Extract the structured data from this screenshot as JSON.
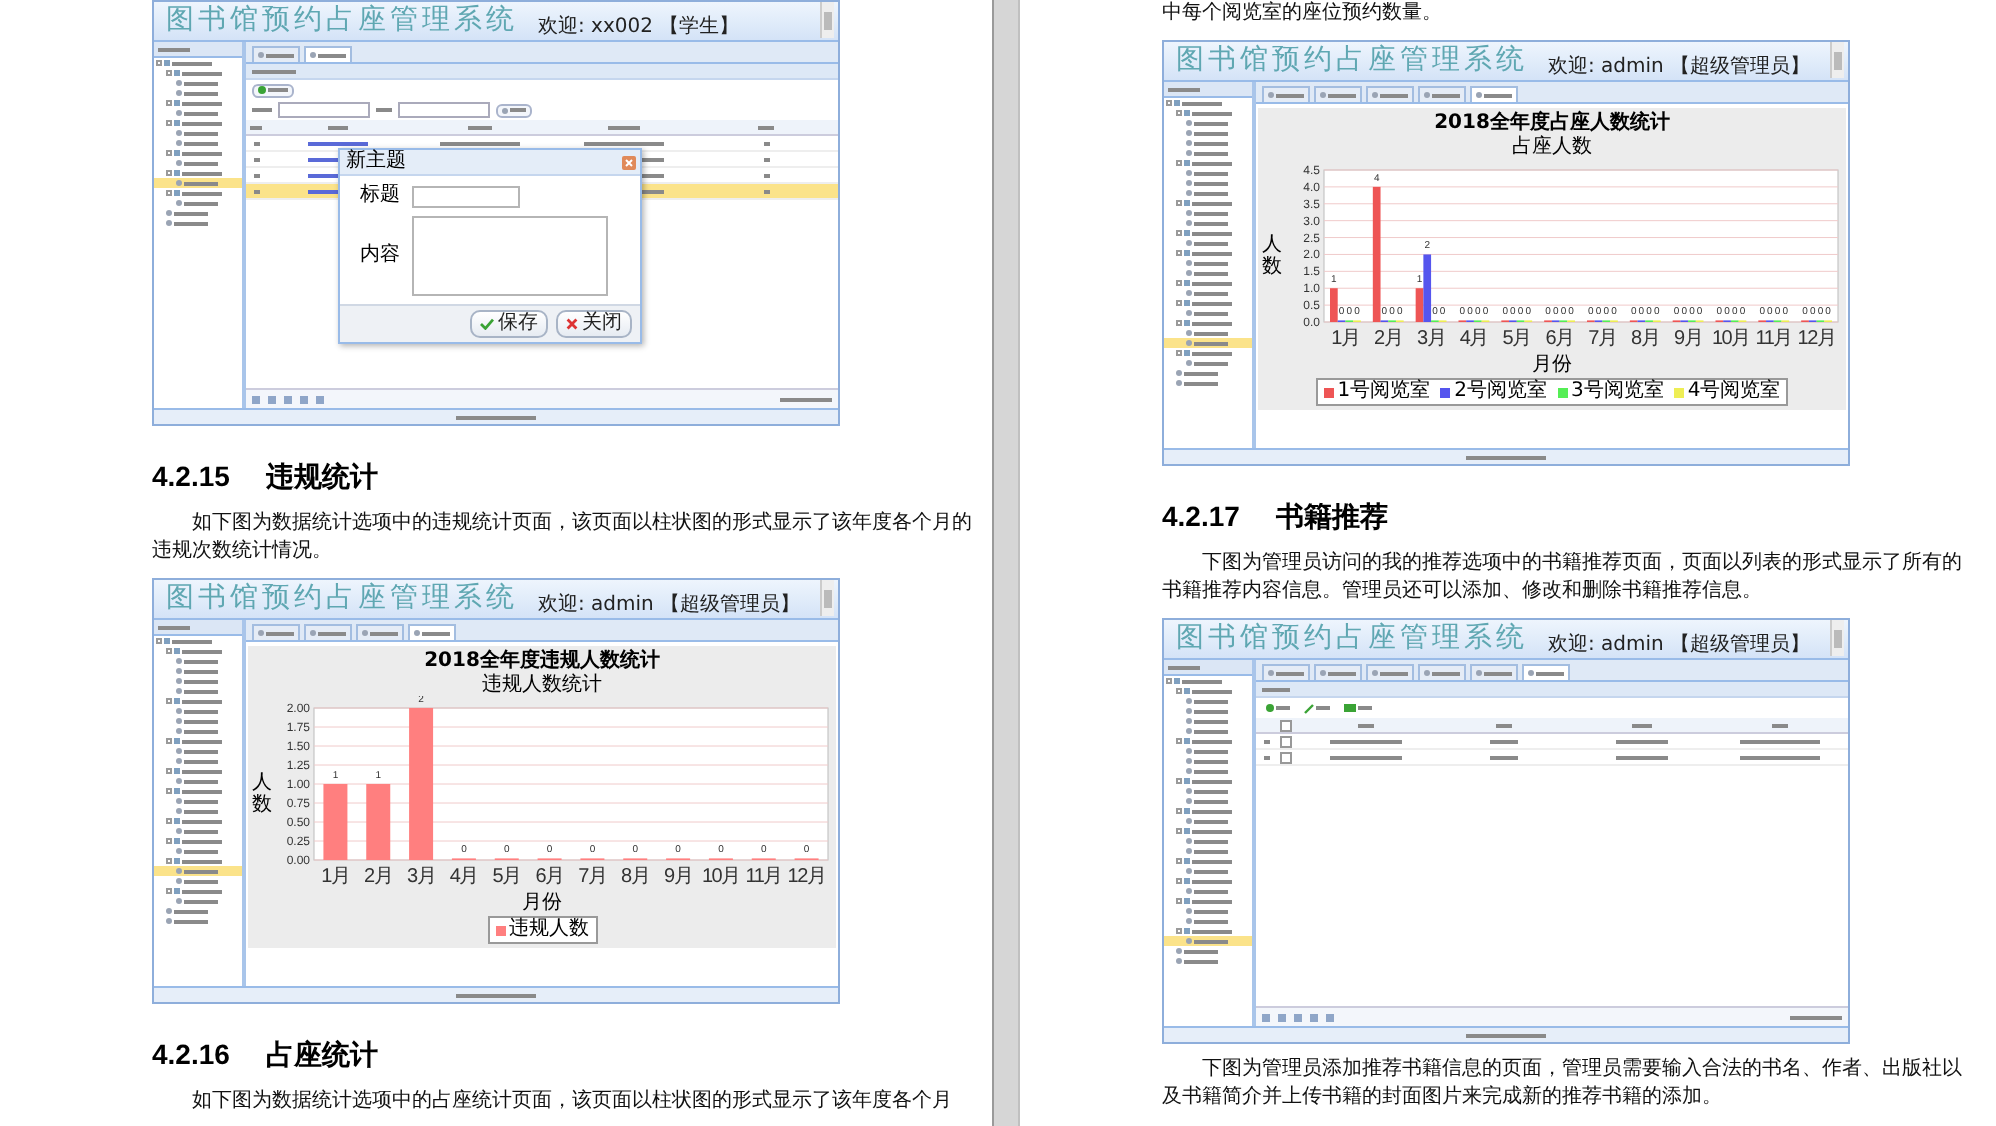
{
  "left_page": {
    "blocks": [
      {
        "kind": "screenshot",
        "app_title": "图书馆预约占座管理系统",
        "welcome": "欢迎: xx002 【学生】",
        "tree": [
          {
            "children": [
              {
                "children": [
                  {
                    "selected": false
                  },
                  {
                    "selected": false
                  }
                ]
              },
              {
                "children": [
                  {
                    "selected": false
                  }
                ]
              },
              {
                "children": [
                  {
                    "selected": false
                  },
                  {
                    "selected": false
                  }
                ]
              },
              {
                "children": [
                  {
                    "selected": false
                  }
                ]
              },
              {
                "children": [
                  {
                    "selected": true
                  }
                ]
              },
              {
                "children": [
                  {
                    "selected": false
                  }
                ]
              },
              {
                "selected": false
              },
              {
                "selected": false
              }
            ]
          }
        ],
        "tabs": [
          {
            "selected": false
          },
          {
            "selected": true
          }
        ],
        "content": {
          "kind": "forum",
          "rows": [
            {
              "selected": false
            },
            {
              "selected": false
            },
            {
              "selected": false
            },
            {
              "selected": true
            }
          ],
          "dialog": {
            "title": "新主题",
            "fields": [
              {
                "kind": "line",
                "label": "标题"
              },
              {
                "kind": "area",
                "label": "内容"
              }
            ],
            "buttons": [
              {
                "kind": "save",
                "label": "保存"
              },
              {
                "kind": "close",
                "label": "关闭"
              }
            ]
          }
        }
      },
      {
        "kind": "heading",
        "number": "4.2.15",
        "title": "违规统计"
      },
      {
        "kind": "paragraph",
        "indent": true,
        "text": "如下图为数据统计选项中的违规统计页面，该页面以柱状图的形式显示了该年度各个月的违规次数统计情况。"
      },
      {
        "kind": "screenshot",
        "app_title": "图书馆预约占座管理系统",
        "welcome": "欢迎: admin 【超级管理员】",
        "tree": [
          {
            "children": [
              {
                "children": [
                  {
                    "selected": false
                  },
                  {
                    "selected": false
                  },
                  {
                    "selected": false
                  },
                  {
                    "selected": false
                  }
                ]
              },
              {
                "children": [
                  {
                    "selected": false
                  },
                  {
                    "selected": false
                  },
                  {
                    "selected": false
                  }
                ]
              },
              {
                "children": [
                  {
                    "selected": false
                  },
                  {
                    "selected": false
                  }
                ]
              },
              {
                "children": [
                  {
                    "selected": false
                  }
                ]
              },
              {
                "children": [
                  {
                    "selected": false
                  },
                  {
                    "selected": false
                  }
                ]
              },
              {
                "children": [
                  {
                    "selected": false
                  }
                ]
              },
              {
                "children": [
                  {
                    "selected": false
                  }
                ]
              },
              {
                "children": [
                  {
                    "selected": true
                  },
                  {
                    "selected": false
                  }
                ]
              },
              {
                "children": [
                  {
                    "selected": false
                  }
                ]
              },
              {
                "selected": false
              },
              {
                "selected": false
              }
            ]
          }
        ],
        "tabs": [
          {
            "selected": false
          },
          {
            "selected": false
          },
          {
            "selected": false
          },
          {
            "selected": true
          }
        ],
        "content": {
          "kind": "chart",
          "subtitle": "违规人数统计",
          "chart_data": {
            "type": "bar",
            "title": "2018全年度违规人数统计",
            "xlabel": "月份",
            "ylabel": "人数",
            "categories": [
              "1月",
              "2月",
              "3月",
              "4月",
              "5月",
              "6月",
              "7月",
              "8月",
              "9月",
              "10月",
              "11月",
              "12月"
            ],
            "series": [
              {
                "name": "违规人数",
                "color": "#ff7f7f",
                "values": [
                  1,
                  1,
                  2,
                  0,
                  0,
                  0,
                  0,
                  0,
                  0,
                  0,
                  0,
                  0
                ]
              }
            ],
            "ylim": [
              0,
              2
            ],
            "yticks": [
              {
                "value": 0,
                "label": "0.00"
              },
              {
                "value": 0.25,
                "label": "0.25"
              },
              {
                "value": 0.5,
                "label": "0.50"
              },
              {
                "value": 0.75,
                "label": "0.75"
              },
              {
                "value": 1,
                "label": "1.00"
              },
              {
                "value": 1.25,
                "label": "1.25"
              },
              {
                "value": 1.5,
                "label": "1.50"
              },
              {
                "value": 1.75,
                "label": "1.75"
              },
              {
                "value": 2,
                "label": "2.00"
              }
            ],
            "grid": true,
            "legend": "bottom",
            "data_labels": true
          }
        }
      },
      {
        "kind": "heading",
        "number": "4.2.16",
        "title": "占座统计"
      },
      {
        "kind": "paragraph",
        "indent": true,
        "text": "如下图为数据统计选项中的占座统计页面，该页面以柱状图的形式显示了该年度各个月"
      }
    ]
  },
  "right_page": {
    "blocks": [
      {
        "kind": "paragraph",
        "indent": false,
        "text": "中每个阅览室的座位预约数量。"
      },
      {
        "kind": "screenshot",
        "app_title": "图书馆预约占座管理系统",
        "welcome": "欢迎: admin 【超级管理员】",
        "tree": [
          {
            "children": [
              {
                "children": [
                  {
                    "selected": false
                  },
                  {
                    "selected": false
                  },
                  {
                    "selected": false
                  },
                  {
                    "selected": false
                  }
                ]
              },
              {
                "children": [
                  {
                    "selected": false
                  },
                  {
                    "selected": false
                  },
                  {
                    "selected": false
                  }
                ]
              },
              {
                "children": [
                  {
                    "selected": false
                  },
                  {
                    "selected": false
                  }
                ]
              },
              {
                "children": [
                  {
                    "selected": false
                  }
                ]
              },
              {
                "children": [
                  {
                    "selected": false
                  },
                  {
                    "selected": false
                  }
                ]
              },
              {
                "children": [
                  {
                    "selected": false
                  }
                ]
              },
              {
                "children": [
                  {
                    "selected": false
                  }
                ]
              },
              {
                "children": [
                  {
                    "selected": false
                  },
                  {
                    "selected": true
                  }
                ]
              },
              {
                "children": [
                  {
                    "selected": false
                  }
                ]
              },
              {
                "selected": false
              },
              {
                "selected": false
              }
            ]
          }
        ],
        "tabs": [
          {
            "selected": false
          },
          {
            "selected": false
          },
          {
            "selected": false
          },
          {
            "selected": false
          },
          {
            "selected": true
          }
        ],
        "content": {
          "kind": "chart",
          "subtitle": "占座人数",
          "chart_data": {
            "type": "bar",
            "title": "2018全年度占座人数统计",
            "xlabel": "月份",
            "ylabel": "人数",
            "categories": [
              "1月",
              "2月",
              "3月",
              "4月",
              "5月",
              "6月",
              "7月",
              "8月",
              "9月",
              "10月",
              "11月",
              "12月"
            ],
            "series": [
              {
                "name": "1号阅览室",
                "color": "#ee5555",
                "values": [
                  1,
                  4,
                  1,
                  0,
                  0,
                  0,
                  0,
                  0,
                  0,
                  0,
                  0,
                  0
                ]
              },
              {
                "name": "2号阅览室",
                "color": "#5555ee",
                "values": [
                  0,
                  0,
                  2,
                  0,
                  0,
                  0,
                  0,
                  0,
                  0,
                  0,
                  0,
                  0
                ]
              },
              {
                "name": "3号阅览室",
                "color": "#55ee55",
                "values": [
                  0,
                  0,
                  0,
                  0,
                  0,
                  0,
                  0,
                  0,
                  0,
                  0,
                  0,
                  0
                ]
              },
              {
                "name": "4号阅览室",
                "color": "#eeee55",
                "values": [
                  0,
                  0,
                  0,
                  0,
                  0,
                  0,
                  0,
                  0,
                  0,
                  0,
                  0,
                  0
                ]
              }
            ],
            "ylim": [
              0,
              4.5
            ],
            "yticks": [
              {
                "value": 0,
                "label": "0.0"
              },
              {
                "value": 0.5,
                "label": "0.5"
              },
              {
                "value": 1,
                "label": "1.0"
              },
              {
                "value": 1.5,
                "label": "1.5"
              },
              {
                "value": 2,
                "label": "2.0"
              },
              {
                "value": 2.5,
                "label": "2.5"
              },
              {
                "value": 3,
                "label": "3.0"
              },
              {
                "value": 3.5,
                "label": "3.5"
              },
              {
                "value": 4,
                "label": "4.0"
              },
              {
                "value": 4.5,
                "label": "4.5"
              }
            ],
            "grid": true,
            "legend": "bottom",
            "data_labels": true
          }
        }
      },
      {
        "kind": "heading",
        "number": "4.2.17",
        "title": "书籍推荐"
      },
      {
        "kind": "paragraph",
        "indent": true,
        "text": "下图为管理员访问的我的推荐选项中的书籍推荐页面，页面以列表的形式显示了所有的书籍推荐内容信息。管理员还可以添加、修改和删除书籍推荐信息。"
      },
      {
        "kind": "screenshot",
        "app_title": "图书馆预约占座管理系统",
        "welcome": "欢迎: admin 【超级管理员】",
        "tree": [
          {
            "children": [
              {
                "children": [
                  {
                    "selected": false
                  },
                  {
                    "selected": false
                  },
                  {
                    "selected": false
                  },
                  {
                    "selected": false
                  }
                ]
              },
              {
                "children": [
                  {
                    "selected": false
                  },
                  {
                    "selected": false
                  },
                  {
                    "selected": false
                  }
                ]
              },
              {
                "children": [
                  {
                    "selected": false
                  },
                  {
                    "selected": false
                  }
                ]
              },
              {
                "children": [
                  {
                    "selected": false
                  }
                ]
              },
              {
                "children": [
                  {
                    "selected": false
                  },
                  {
                    "selected": false
                  }
                ]
              },
              {
                "children": [
                  {
                    "selected": false
                  }
                ]
              },
              {
                "children": [
                  {
                    "selected": false
                  }
                ]
              },
              {
                "children": [
                  {
                    "selected": false
                  },
                  {
                    "selected": false
                  }
                ]
              },
              {
                "children": [
                  {
                    "selected": true
                  }
                ]
              },
              {
                "selected": false
              },
              {
                "selected": false
              }
            ]
          }
        ],
        "tabs": [
          {
            "selected": false
          },
          {
            "selected": false
          },
          {
            "selected": false
          },
          {
            "selected": false
          },
          {
            "selected": false
          },
          {
            "selected": true
          }
        ],
        "content": {
          "kind": "list",
          "header_checked": false,
          "rows": [
            {
              "checked": false
            },
            {
              "checked": false
            }
          ]
        }
      },
      {
        "kind": "paragraph",
        "indent": true,
        "text": "下图为管理员添加推荐书籍信息的页面，管理员需要输入合法的书名、作者、出版社以及书籍简介并上传书籍的封面图片来完成新的推荐书籍的添加。"
      }
    ]
  }
}
